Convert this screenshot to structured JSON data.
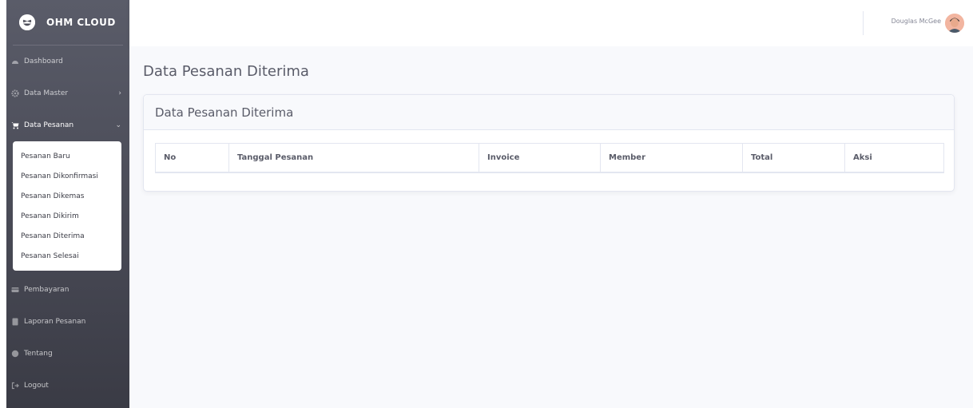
{
  "brand": {
    "name": "OHM CLOUD"
  },
  "sidebar": {
    "items": [
      {
        "label": "Dashboard",
        "icon": "dashboard-icon"
      },
      {
        "label": "Data Master",
        "icon": "gear-icon"
      },
      {
        "label": "Data Pesanan",
        "icon": "cart-icon"
      },
      {
        "label": "Pembayaran",
        "icon": "credit-card-icon"
      },
      {
        "label": "Laporan Pesanan",
        "icon": "book-icon"
      },
      {
        "label": "Tentang",
        "icon": "globe-icon"
      },
      {
        "label": "Logout",
        "icon": "logout-icon"
      }
    ],
    "submenu": [
      "Pesanan Baru",
      "Pesanan Dikonfirmasi",
      "Pesanan Dikemas",
      "Pesanan Dikirim",
      "Pesanan Diterima",
      "Pesanan Selesai"
    ]
  },
  "topbar": {
    "user_name": "Douglas McGee"
  },
  "page": {
    "title": "Data Pesanan Diterima"
  },
  "card": {
    "title": "Data Pesanan Diterima",
    "columns": [
      "No",
      "Tanggal Pesanan",
      "Invoice",
      "Member",
      "Total",
      "Aksi"
    ]
  },
  "colors": {
    "sidebar": "#4e4f5a",
    "content_bg": "#f8f9fc",
    "text": "#5a5c69"
  }
}
